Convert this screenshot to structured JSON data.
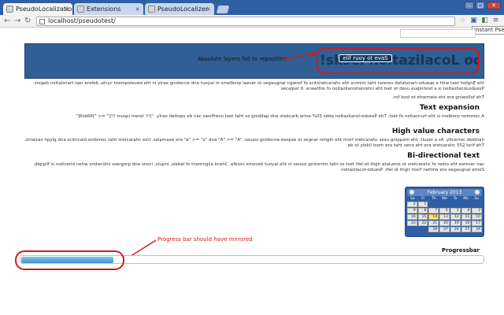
{
  "browser": {
    "tabs": [
      {
        "label": "PseudoLocalization"
      },
      {
        "label": "Extensions"
      },
      {
        "label": "PseudoLocalizer"
      }
    ],
    "url": "localhost/pseudotest/",
    "tooltip": "Instant Pseud"
  },
  "banner": {
    "title": "!sksel noitazilacoL oduesP",
    "note": "Absolute layers fail to reposition",
    "file_button": "elif ruoy ot evaS"
  },
  "content": {
    "para1": "PseudoLocalization is a technique used to test the internationalization of software. It replaces the English text with a pseudo-translated version that mimics the characteristics of foreign languages to reveal problems in layout and encoding early in the development cycle, before real translation begins.",
    "para2": "The following are the elements to look for.",
    "h_text_expansion": "Text expansion",
    "para3": "A common problem is the truncation of text. The Pseudo-localization adds 50% extra brackets and padding so that text overflows can be spotted early. \"[!!! lorem ipsum !!!]\" => \"[Þßëûð]\"",
    "h_high_value": "High value characters",
    "para4": "The first 255 characters are the ones that are most likely to be handled correctly. As a result, the mapping uses characters from the higher ranges to expose encoding issues. \"A\" => \"Å\" and \"o\" => \"ø\" are examples. Use characters that combine diacritics and glyph variants.",
    "h_bidi": "Bi-directional text",
    "para5": "Some languages are written from right to left. Pseudo-localization can reverse the order of characters to simulate right-to-left text so that mirroring issues in the layout become visible. Check alignment of labels, inputs, icons and progress indicators when direction is flipped.",
    "progress_label": "Progressbar",
    "progress_value": 0.2
  },
  "annotations": {
    "banner_note": "Absolute layers fail to reposition",
    "progress_note": "Progress bar should have mirrored"
  },
  "calendar": {
    "header": "February 2013",
    "dow": [
      "Su",
      "Mo",
      "Tu",
      "We",
      "Th",
      "Fr",
      "Sa"
    ],
    "weeks": [
      [
        "",
        "",
        "",
        "",
        "",
        "1",
        "2"
      ],
      [
        "3",
        "4",
        "5",
        "6",
        "7",
        "8",
        "9"
      ],
      [
        "10",
        "11",
        "12",
        "13",
        "14",
        "15",
        "16"
      ],
      [
        "17",
        "18",
        "19",
        "20",
        "21",
        "22",
        "23"
      ],
      [
        "24",
        "25",
        "26",
        "27",
        "28",
        "",
        ""
      ]
    ],
    "today": "14"
  },
  "colors": {
    "annotation_red": "#d61818",
    "banner_blue": "#2f5f95",
    "progress_blue": "#3f91d2"
  }
}
